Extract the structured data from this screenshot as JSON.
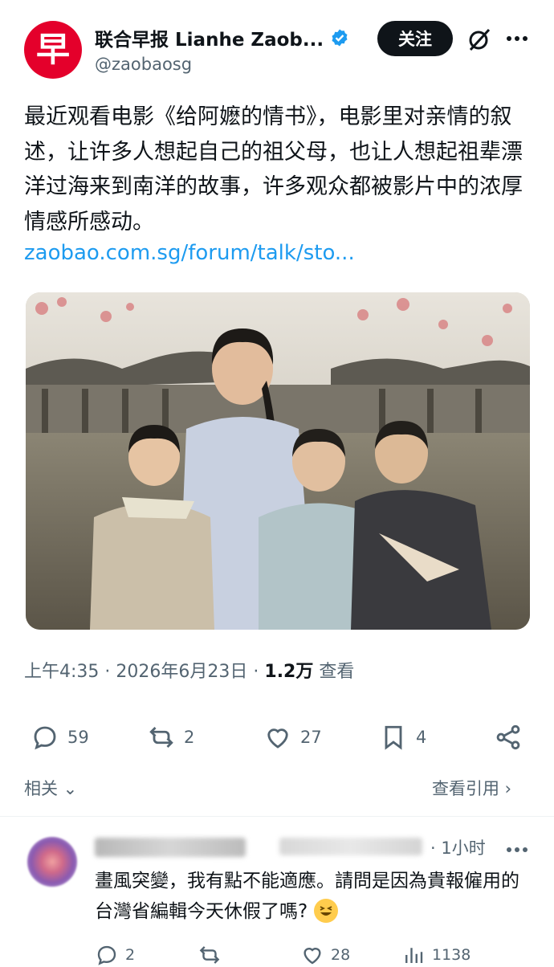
{
  "post": {
    "avatar_glyph": "早",
    "display_name": "联合早报 Lianhe Zaob...",
    "handle": "@zaobaosg",
    "follow_label": "关注",
    "text": "最近观看电影《给阿嬷的情书》，电影里对亲情的叙述，让许多人想起自己的祖父母，也让人想起祖辈漂洋过海来到南洋的故事，许多观众都被影片中的浓厚情感所感动。",
    "link": "zaobao.com.sg/forum/talk/sto...",
    "time": "上午4:35",
    "date": "2026年6月23日",
    "views": "1.2万",
    "views_label": "查看"
  },
  "actions": {
    "replies": "59",
    "reposts": "2",
    "likes": "27",
    "bookmarks": "4"
  },
  "links": {
    "related": "相关",
    "quotes": "查看引用"
  },
  "reply": {
    "time": "· 1小时",
    "text": "畫風突變，我有點不能適應。請問是因為貴報僱用的台灣省編輯今天休假了嗎?",
    "replies": "2",
    "likes": "28",
    "views": "1138"
  },
  "colors": {
    "accent": "#1d9bf0",
    "brand": "#e4002b",
    "muted": "#536471"
  }
}
